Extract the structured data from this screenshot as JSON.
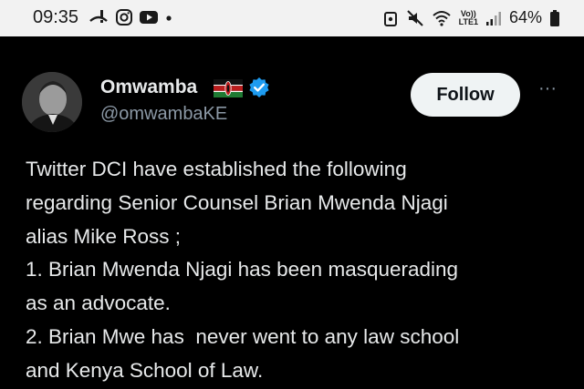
{
  "status_bar": {
    "time": "09:35",
    "battery": "64%",
    "network_label_top": "Vo))",
    "network_label_bottom": "LTE1",
    "icons": [
      "missed-call-icon",
      "instagram-icon",
      "youtube-icon",
      "dot-icon",
      "lock-icon",
      "mute-icon",
      "wifi-icon",
      "signal-icon",
      "battery-icon"
    ]
  },
  "tweet": {
    "author_name": "Omwamba",
    "handle": "@omwambaKE",
    "follow_label": "Follow",
    "more_label": "···",
    "lines": [
      "Twitter DCI have established the following",
      "regarding Senior Counsel Brian Mwenda Njagi",
      "alias Mike Ross ;",
      "1. Brian Mwenda Njagi has been masquerading",
      "as an advocate.",
      "2. Brian Mwe has  never went to any law school",
      "and Kenya School of Law."
    ]
  },
  "colors": {
    "background": "#000000",
    "text": "#e7e9ea",
    "secondary_text": "#8b98a5",
    "verified_blue": "#1d9bf0",
    "status_bar_bg": "#f2f2f2"
  }
}
